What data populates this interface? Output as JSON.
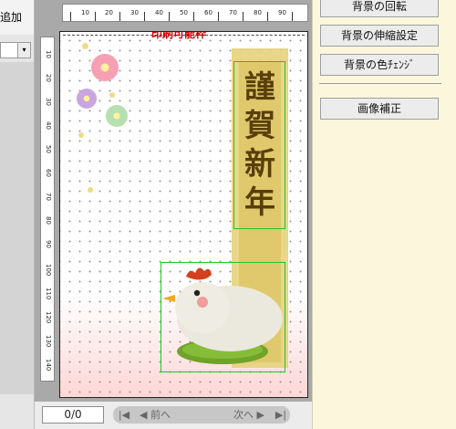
{
  "left_panel": {
    "add_label": "追加",
    "combo_arrow": "▾"
  },
  "ruler": {
    "horizontal_ticks": [
      "10",
      "20",
      "30",
      "40",
      "50",
      "60",
      "70",
      "80",
      "90"
    ],
    "vertical_ticks": [
      "10",
      "20",
      "30",
      "40",
      "50",
      "60",
      "70",
      "80",
      "90",
      "100",
      "110",
      "120",
      "130",
      "140"
    ]
  },
  "card": {
    "print_area_label": "印刷可能枠",
    "greeting_chars": [
      "謹",
      "賀",
      "新",
      "年"
    ]
  },
  "nav": {
    "page_value": "0/0",
    "first_icon": "|◀",
    "prev_label": "◀ 前へ",
    "next_label": "次へ ▶",
    "last_icon": "▶|"
  },
  "right_panel": {
    "buttons": [
      "背景の回転",
      "背景の伸縮設定",
      "背景の色ﾁｪﾝｼﾞ",
      "画像補正"
    ]
  },
  "colors": {
    "print_label": "#d00000",
    "selection_box": "#27c227",
    "right_panel_bg": "#fcf7dc"
  }
}
